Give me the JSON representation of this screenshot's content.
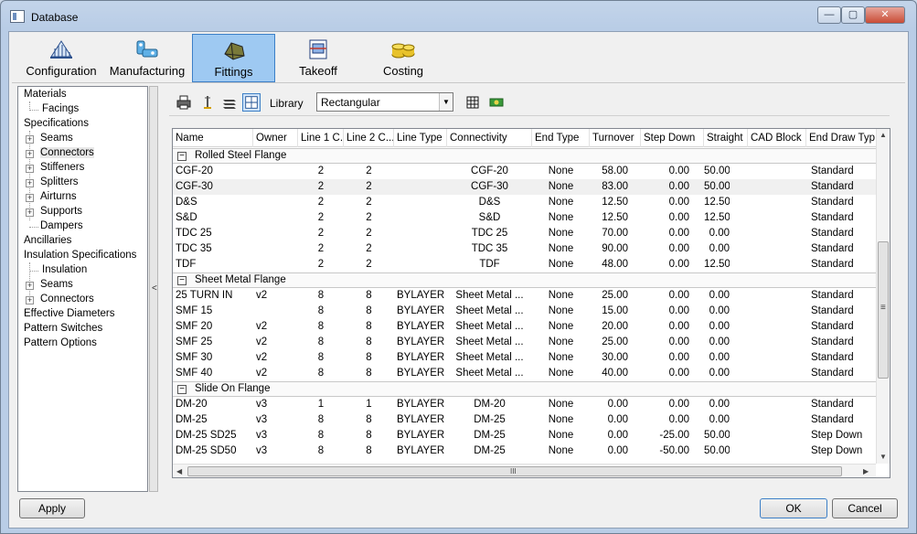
{
  "window": {
    "title": "Database",
    "min": "—",
    "max": "▢",
    "close": "✕"
  },
  "ribbon": [
    {
      "label": "Configuration"
    },
    {
      "label": "Manufacturing"
    },
    {
      "label": "Fittings"
    },
    {
      "label": "Takeoff"
    },
    {
      "label": "Costing"
    }
  ],
  "tree": [
    {
      "label": "Materials"
    },
    {
      "label": "Facings"
    },
    {
      "label": "Specifications"
    },
    {
      "label": "Seams"
    },
    {
      "label": "Connectors"
    },
    {
      "label": "Stiffeners"
    },
    {
      "label": "Splitters"
    },
    {
      "label": "Airturns"
    },
    {
      "label": "Supports"
    },
    {
      "label": "Dampers"
    },
    {
      "label": "Ancillaries"
    },
    {
      "label": "Insulation Specifications"
    },
    {
      "label": "Insulation"
    },
    {
      "label": "Seams"
    },
    {
      "label": "Connectors"
    },
    {
      "label": "Effective Diameters"
    },
    {
      "label": "Pattern Switches"
    },
    {
      "label": "Pattern Options"
    }
  ],
  "toolbar": {
    "library_label": "Library",
    "dropdown_value": "Rectangular"
  },
  "columns": [
    "Name",
    "Owner",
    "Line 1 C...",
    "Line 2 C...",
    "Line Type",
    "Connectivity",
    "End Type",
    "Turnover",
    "Step Down",
    "Straight",
    "CAD Block",
    "End Draw Typ"
  ],
  "groups": [
    {
      "label": "Rolled Steel Flange",
      "rows": [
        [
          "CGF-20",
          "",
          "2",
          "2",
          "",
          "CGF-20",
          "None",
          "58.00",
          "0.00",
          "50.00",
          "",
          "Standard"
        ],
        [
          "CGF-30",
          "",
          "2",
          "2",
          "",
          "CGF-30",
          "None",
          "83.00",
          "0.00",
          "50.00",
          "",
          "Standard"
        ],
        [
          "D&S",
          "",
          "2",
          "2",
          "",
          "D&S",
          "None",
          "12.50",
          "0.00",
          "12.50",
          "",
          "Standard"
        ],
        [
          "S&D",
          "",
          "2",
          "2",
          "",
          "S&D",
          "None",
          "12.50",
          "0.00",
          "12.50",
          "",
          "Standard"
        ],
        [
          "TDC 25",
          "",
          "2",
          "2",
          "",
          "TDC 25",
          "None",
          "70.00",
          "0.00",
          "0.00",
          "",
          "Standard"
        ],
        [
          "TDC 35",
          "",
          "2",
          "2",
          "",
          "TDC 35",
          "None",
          "90.00",
          "0.00",
          "0.00",
          "",
          "Standard"
        ],
        [
          "TDF",
          "",
          "2",
          "2",
          "",
          "TDF",
          "None",
          "48.00",
          "0.00",
          "12.50",
          "",
          "Standard"
        ]
      ]
    },
    {
      "label": "Sheet Metal Flange",
      "rows": [
        [
          "25 TURN IN",
          "v2",
          "8",
          "8",
          "BYLAYER",
          "Sheet Metal ...",
          "None",
          "25.00",
          "0.00",
          "0.00",
          "",
          "Standard"
        ],
        [
          "SMF 15",
          "",
          "8",
          "8",
          "BYLAYER",
          "Sheet Metal ...",
          "None",
          "15.00",
          "0.00",
          "0.00",
          "",
          "Standard"
        ],
        [
          "SMF 20",
          "v2",
          "8",
          "8",
          "BYLAYER",
          "Sheet Metal ...",
          "None",
          "20.00",
          "0.00",
          "0.00",
          "",
          "Standard"
        ],
        [
          "SMF 25",
          "v2",
          "8",
          "8",
          "BYLAYER",
          "Sheet Metal ...",
          "None",
          "25.00",
          "0.00",
          "0.00",
          "",
          "Standard"
        ],
        [
          "SMF 30",
          "v2",
          "8",
          "8",
          "BYLAYER",
          "Sheet Metal ...",
          "None",
          "30.00",
          "0.00",
          "0.00",
          "",
          "Standard"
        ],
        [
          "SMF 40",
          "v2",
          "8",
          "8",
          "BYLAYER",
          "Sheet Metal ...",
          "None",
          "40.00",
          "0.00",
          "0.00",
          "",
          "Standard"
        ]
      ]
    },
    {
      "label": "Slide On Flange",
      "rows": [
        [
          "DM-20",
          "v3",
          "1",
          "1",
          "BYLAYER",
          "DM-20",
          "None",
          "0.00",
          "0.00",
          "0.00",
          "",
          "Standard"
        ],
        [
          "DM-25",
          "v3",
          "8",
          "8",
          "BYLAYER",
          "DM-25",
          "None",
          "0.00",
          "0.00",
          "0.00",
          "",
          "Standard"
        ],
        [
          "DM-25 SD25",
          "v3",
          "8",
          "8",
          "BYLAYER",
          "DM-25",
          "None",
          "0.00",
          "-25.00",
          "50.00",
          "",
          "Step Down"
        ],
        [
          "DM-25 SD50",
          "v3",
          "8",
          "8",
          "BYLAYER",
          "DM-25",
          "None",
          "0.00",
          "-50.00",
          "50.00",
          "",
          "Step Down"
        ]
      ]
    }
  ],
  "buttons": {
    "apply": "Apply",
    "ok": "OK",
    "cancel": "Cancel"
  },
  "scroll": {
    "up": "▲",
    "down": "▼",
    "left": "◀",
    "right": "▶",
    "grip_h": "III",
    "grip_v": "≡",
    "splitter": "<"
  },
  "colors": {
    "active_tab": "#9ec9f2",
    "active_border": "#3c7fc7",
    "selected_row": "#f0f0f0"
  }
}
